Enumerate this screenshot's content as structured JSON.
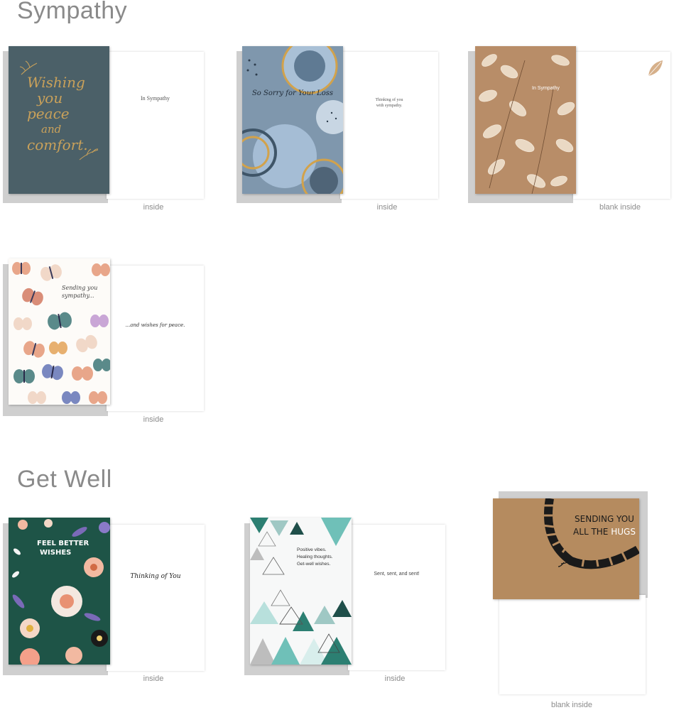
{
  "sections": {
    "sympathy": {
      "title": "Sympathy"
    },
    "get_well": {
      "title": "Get Well"
    }
  },
  "cards": {
    "c1": {
      "front_text": [
        "Wishing",
        "you",
        "peace",
        "and",
        "comfort."
      ],
      "inside_text": "In Sympathy",
      "caption": "inside",
      "colors": {
        "front": "#4b6068",
        "accent": "#c9a15a"
      }
    },
    "c2": {
      "front_text": "So Sorry for Your Loss",
      "inside_text_1": "Thinking of you",
      "inside_text_2": "with sympathy.",
      "caption": "inside",
      "colors": {
        "front": "#7f97ad",
        "accent": "#d2a24b"
      }
    },
    "c3": {
      "front_text": "In Sympathy",
      "inside_icon": "leaf-icon",
      "caption": "blank inside",
      "colors": {
        "front": "#b88d68"
      }
    },
    "c4": {
      "front_text_1": "Sending you",
      "front_text_2": "sympathy...",
      "inside_text": "...and wishes for peace.",
      "caption": "inside",
      "colors": {
        "front": "#fdfbf8"
      }
    },
    "c5": {
      "front_text_1": "FEEL BETTER",
      "front_text_2": "WISHES",
      "inside_text": "Thinking of You",
      "caption": "inside",
      "colors": {
        "front": "#1e5447"
      }
    },
    "c6": {
      "front_text_1": "Positive vibes.",
      "front_text_2": "Healing thoughts.",
      "front_text_3": "Get-well wishes.",
      "inside_text": "Sent, sent, and sent!",
      "caption": "inside",
      "colors": {
        "front": "#f7f8f8",
        "accent": "#1f6f66"
      }
    },
    "c7": {
      "front_text_1": "SENDING YOU",
      "front_text_2": "ALL THE",
      "front_text_3": "HUGS",
      "caption": "blank inside",
      "colors": {
        "front": "#b58b5f"
      }
    }
  }
}
